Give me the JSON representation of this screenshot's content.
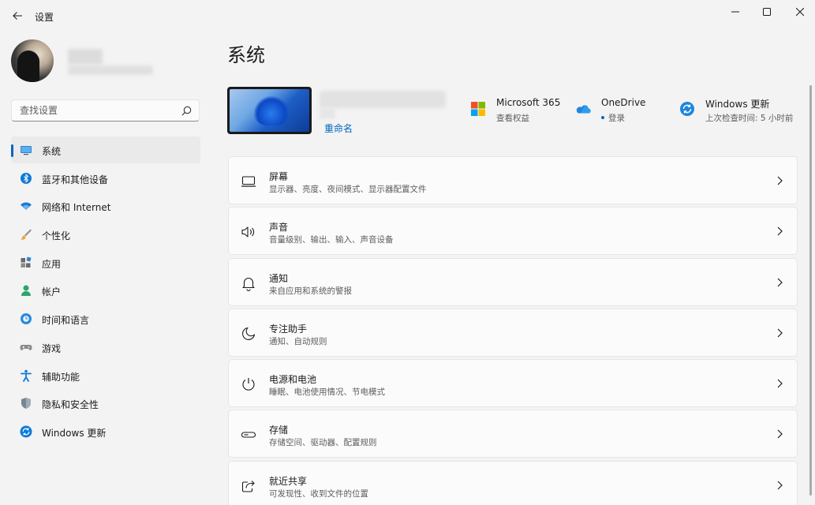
{
  "window": {
    "title": "设置",
    "controls": [
      "minimize-icon",
      "maximize-icon",
      "close-icon"
    ]
  },
  "sidebar": {
    "search_placeholder": "查找设置",
    "items": [
      {
        "label": "系统",
        "icon": "system-display-icon",
        "selected": true
      },
      {
        "label": "蓝牙和其他设备",
        "icon": "bluetooth-icon"
      },
      {
        "label": "网络和 Internet",
        "icon": "wifi-icon"
      },
      {
        "label": "个性化",
        "icon": "brush-icon"
      },
      {
        "label": "应用",
        "icon": "apps-icon"
      },
      {
        "label": "帐户",
        "icon": "account-icon"
      },
      {
        "label": "时间和语言",
        "icon": "globe-clock-icon"
      },
      {
        "label": "游戏",
        "icon": "gamepad-icon"
      },
      {
        "label": "辅助功能",
        "icon": "accessibility-icon"
      },
      {
        "label": "隐私和安全性",
        "icon": "shield-icon"
      },
      {
        "label": "Windows 更新",
        "icon": "windows-update-icon"
      }
    ]
  },
  "main": {
    "title": "系统",
    "device": {
      "rename_label": "重命名"
    },
    "quick_links": [
      {
        "title": "Microsoft 365",
        "subtitle": "查看权益",
        "icon": "microsoft-logo-icon"
      },
      {
        "title": "OneDrive",
        "subtitle": "登录",
        "icon": "onedrive-cloud-icon"
      },
      {
        "title": "Windows 更新",
        "subtitle": "上次检查时间: 5 小时前",
        "icon": "windows-update-icon"
      }
    ],
    "cards": [
      {
        "title": "屏幕",
        "subtitle": "显示器、亮度、夜间模式、显示器配置文件",
        "icon": "monitor-icon"
      },
      {
        "title": "声音",
        "subtitle": "音量级别、输出、输入、声音设备",
        "icon": "speaker-icon"
      },
      {
        "title": "通知",
        "subtitle": "来自应用和系统的警报",
        "icon": "bell-icon"
      },
      {
        "title": "专注助手",
        "subtitle": "通知、自动规则",
        "icon": "moon-icon"
      },
      {
        "title": "电源和电池",
        "subtitle": "睡眠、电池使用情况、节电模式",
        "icon": "power-icon"
      },
      {
        "title": "存储",
        "subtitle": "存储空间、驱动器、配置规则",
        "icon": "storage-drive-icon"
      },
      {
        "title": "就近共享",
        "subtitle": "可发现性、收到文件的位置",
        "icon": "share-icon"
      }
    ]
  },
  "colors": {
    "accent": "#0067c0",
    "background": "#f3f3f3",
    "card": "#fbfbfb"
  }
}
